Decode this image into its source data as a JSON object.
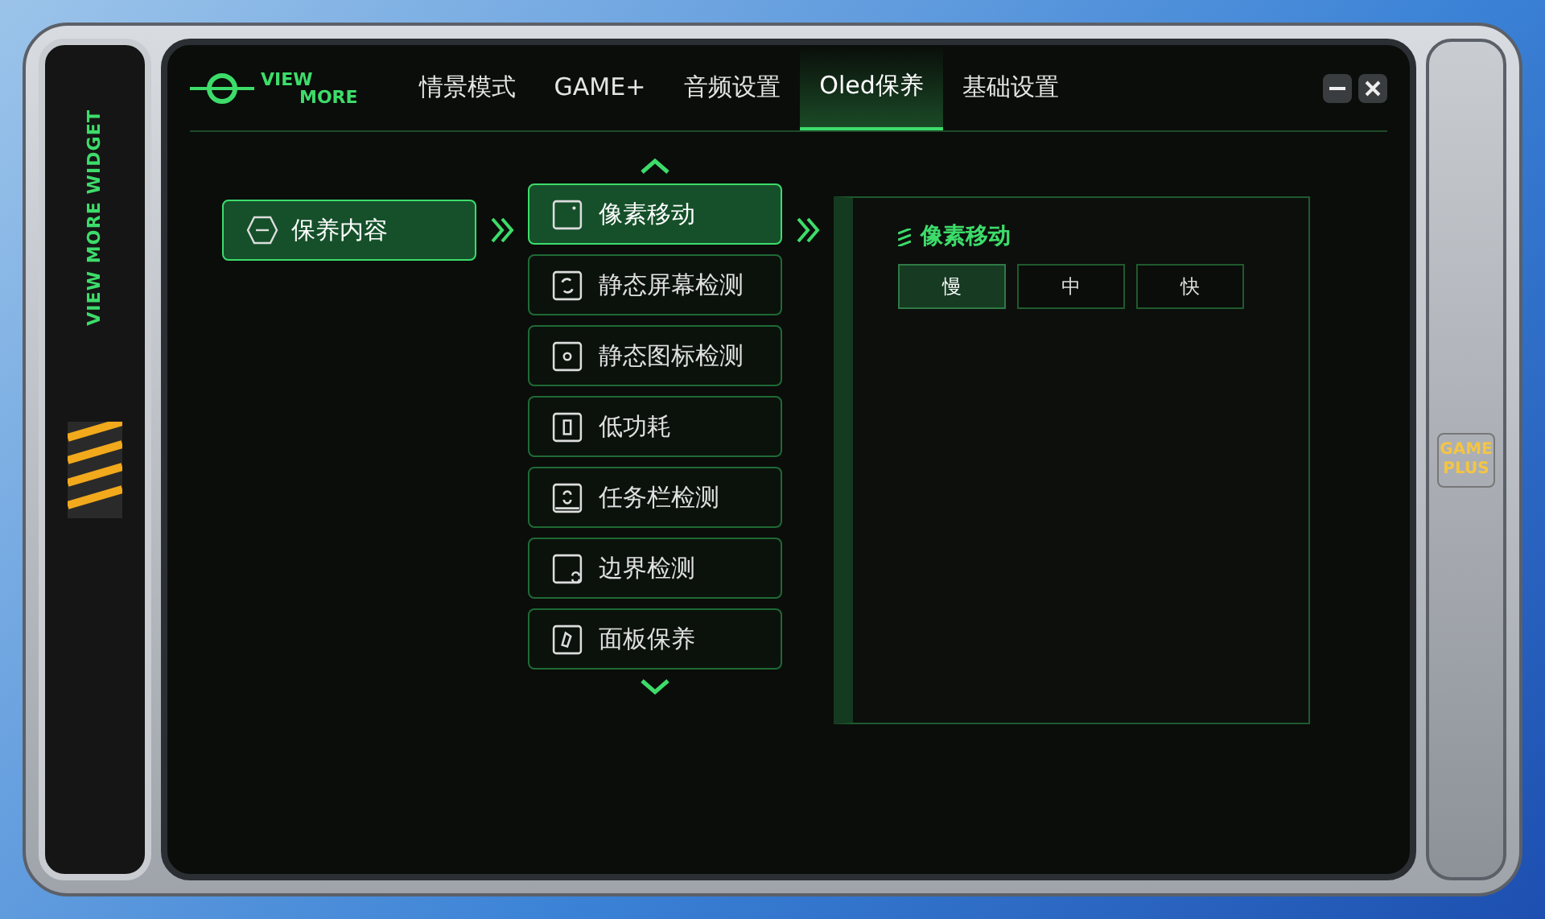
{
  "side_label": "VIEW MORE WIDGET",
  "logo": {
    "line1": "VIEW",
    "line2": "MORE"
  },
  "tabs": [
    {
      "label": "情景模式",
      "selected": false
    },
    {
      "label": "GAME+",
      "selected": false
    },
    {
      "label": "音频设置",
      "selected": false
    },
    {
      "label": "Oled保养",
      "selected": true
    },
    {
      "label": "基础设置",
      "selected": false
    }
  ],
  "categories": [
    {
      "label": "保养内容",
      "selected": true
    }
  ],
  "features": [
    {
      "label": "像素移动",
      "selected": true
    },
    {
      "label": "静态屏幕检测",
      "selected": false
    },
    {
      "label": "静态图标检测",
      "selected": false
    },
    {
      "label": "低功耗",
      "selected": false
    },
    {
      "label": "任务栏检测",
      "selected": false
    },
    {
      "label": "边界检测",
      "selected": false
    },
    {
      "label": "面板保养",
      "selected": false
    }
  ],
  "detail": {
    "title": "像素移动",
    "options": [
      {
        "label": "慢",
        "selected": true
      },
      {
        "label": "中",
        "selected": false
      },
      {
        "label": "快",
        "selected": false
      }
    ]
  },
  "badge": "GAME PLUS"
}
